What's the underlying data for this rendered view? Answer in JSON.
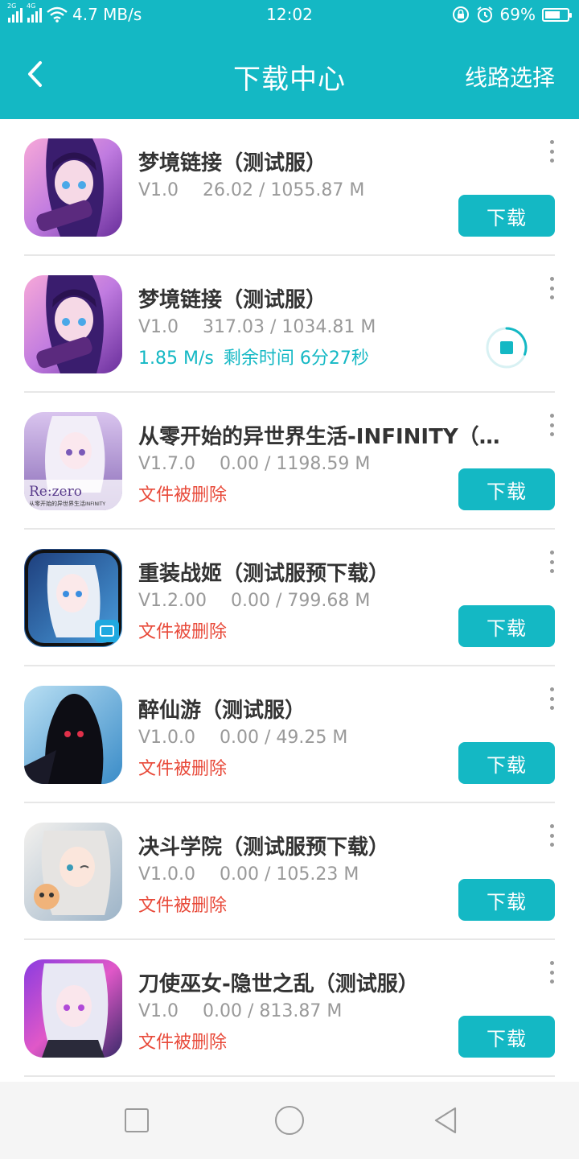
{
  "status_bar": {
    "net_speed": "4.7 MB/s",
    "time": "12:02",
    "battery": "69%",
    "battery_level": 0.69,
    "sim1_tag": "2G",
    "sim2_tag": "4G"
  },
  "header": {
    "title": "下载中心",
    "route_label": "线路选择"
  },
  "colors": {
    "accent": "#14b8c4",
    "deleted": "#e84a3a",
    "meta": "#999999"
  },
  "items": [
    {
      "name": "梦境链接（测试服）",
      "version": "V1.0",
      "size": "26.02 / 1055.87 M",
      "status": "",
      "action": "下载"
    },
    {
      "name": "梦境链接（测试服）",
      "version": "V1.0",
      "size": "317.03 / 1034.81 M",
      "speed": "1.85 M/s",
      "remaining": "剩余时间 6分27秒",
      "progress": 0.306
    },
    {
      "name": "从零开始的异世界生活-INFINITY（测试服）",
      "version": "V1.7.0",
      "size": "0.00 / 1198.59 M",
      "status": "文件被删除",
      "action": "下载"
    },
    {
      "name": "重装战姬（测试服预下载）",
      "version": "V1.2.00",
      "size": "0.00 / 799.68 M",
      "status": "文件被删除",
      "action": "下载"
    },
    {
      "name": "醉仙游（测试服）",
      "version": "V1.0.0",
      "size": "0.00 / 49.25 M",
      "status": "文件被删除",
      "action": "下载"
    },
    {
      "name": "决斗学院（测试服预下载）",
      "version": "V1.0.0",
      "size": "0.00 / 105.23 M",
      "status": "文件被删除",
      "action": "下载"
    },
    {
      "name": "刀使巫女-隐世之乱（测试服）",
      "version": "V1.0",
      "size": "0.00 / 813.87 M",
      "status": "文件被删除",
      "action": "下载"
    }
  ],
  "icons": {
    "back": "chevron-left-icon",
    "more": "more-vertical-icon",
    "pause": "pause-download-icon",
    "nav_recent": "square-icon",
    "nav_home": "circle-icon",
    "nav_back": "triangle-back-icon"
  },
  "game_logos": {
    "rezero_logo": "Re:zero",
    "rezero_sub": "从零开始的异世界生活",
    "rezero_infinity": "INFINITY"
  }
}
